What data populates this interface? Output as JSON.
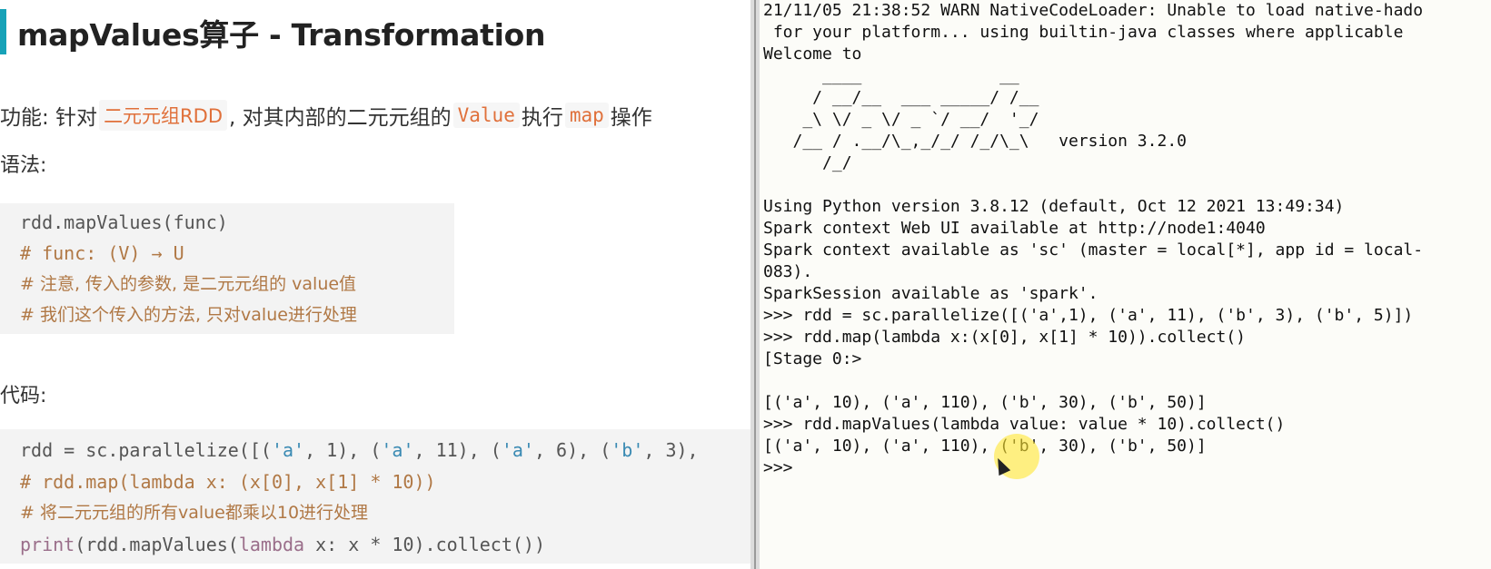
{
  "doc": {
    "title": "mapValues算子 - Transformation",
    "feature": {
      "prefix": "功能: 针对",
      "hl1": "二元元组RDD",
      "mid1": ", 对其内部的二元元组的",
      "hl2": "Value",
      "mid2": "执行",
      "hl3": "map",
      "suffix": "操作"
    },
    "syntax_label": "语法:",
    "syntax_code": [
      "rdd.mapValues(func)",
      "# func:  (V) → U",
      "# 注意, 传入的参数, 是二元元组的 value值",
      "# 我们这个传入的方法, 只对value进行处理"
    ],
    "code_label": "代码:",
    "code": {
      "line1": {
        "a": "rdd = sc.parallelize([(",
        "s1": "'a'",
        "b": ", 1), (",
        "s2": "'a'",
        "c": ", 11), (",
        "s3": "'a'",
        "d": ", 6), (",
        "s4": "'b'",
        "e": ", 3),"
      },
      "line2": "# rdd.map(lambda x: (x[0], x[1] * 10))",
      "line3": "# 将二元元组的所有value都乘以10进行处理",
      "line4": {
        "a": "print",
        "b": "(rdd.mapValues(",
        "c": "lambda",
        "d": " x: x * 10).collect())"
      }
    }
  },
  "terminal": {
    "lines": [
      "21/11/05 21:38:52 WARN NativeCodeLoader: Unable to load native-hado",
      " for your platform... using builtin-java classes where applicable",
      "Welcome to",
      "      ____              __",
      "     / __/__  ___ _____/ /__",
      "    _\\ \\/ _ \\/ _ `/ __/  '_/",
      "   /__ / .__/\\_,_/_/ /_/\\_\\   version 3.2.0",
      "      /_/",
      "",
      "Using Python version 3.8.12 (default, Oct 12 2021 13:49:34)",
      "Spark context Web UI available at http://node1:4040",
      "Spark context available as 'sc' (master = local[*], app id = local-",
      "083).",
      "SparkSession available as 'spark'.",
      ">>> rdd = sc.parallelize([('a',1), ('a', 11), ('b', 3), ('b', 5)])",
      ">>> rdd.map(lambda x:(x[0], x[1] * 10)).collect()",
      "[Stage 0:>",
      "",
      "[('a', 10), ('a', 110), ('b', 30), ('b', 50)]",
      ">>> rdd.mapValues(lambda value: value * 10).collect()",
      "[('a', 10), ('a', 110), ('b', 30), ('b', 50)]",
      ">>>"
    ]
  },
  "colors": {
    "accent": "#17a2b8",
    "highlight_text": "#e0703a",
    "comment": "#b07845",
    "string": "#3a8ab3",
    "cursor_highlight": "#ffe632"
  }
}
